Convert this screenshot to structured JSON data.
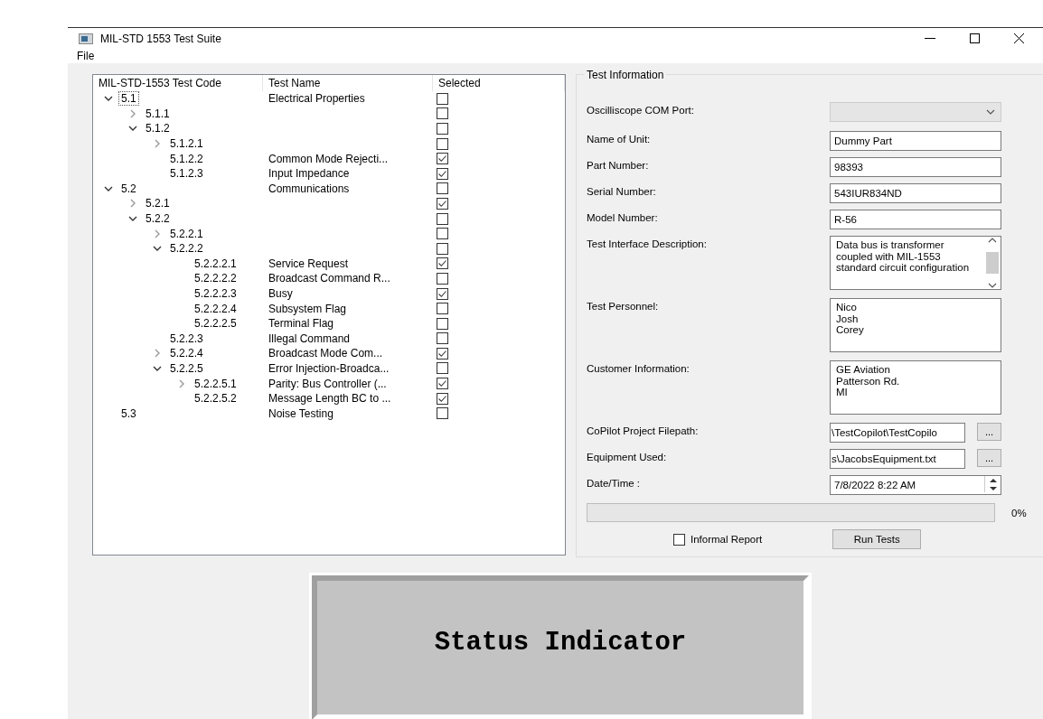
{
  "window": {
    "title": "MIL-STD 1553 Test Suite"
  },
  "menu": [
    "File"
  ],
  "tree": {
    "columns": [
      "MIL-STD-1553 Test Code",
      "Test Name",
      "Selected"
    ],
    "items": [
      {
        "code": "5.1",
        "name": "Electrical Properties",
        "checked": false,
        "selected": true,
        "expanded": true,
        "children": [
          {
            "code": "5.1.1",
            "checked": false,
            "selected": false,
            "expanded": false
          },
          {
            "code": "5.1.2",
            "checked": false,
            "selected": false,
            "expanded": true,
            "children": [
              {
                "code": "5.1.2.1",
                "checked": false,
                "selected": false,
                "expanded": false
              },
              {
                "code": "5.1.2.2",
                "name": "Common Mode Rejecti...",
                "checked": true,
                "selected": false
              },
              {
                "code": "5.1.2.3",
                "name": "Input Impedance",
                "checked": true,
                "selected": false
              }
            ]
          }
        ]
      },
      {
        "code": "5.2",
        "name": "Communications",
        "checked": false,
        "selected": false,
        "expanded": true,
        "children": [
          {
            "code": "5.2.1",
            "checked": true,
            "selected": false,
            "expanded": false
          },
          {
            "code": "5.2.2",
            "checked": false,
            "selected": false,
            "expanded": true,
            "children": [
              {
                "code": "5.2.2.1",
                "checked": false,
                "selected": false,
                "expanded": false
              },
              {
                "code": "5.2.2.2",
                "checked": false,
                "selected": false,
                "expanded": true,
                "children": [
                  {
                    "code": "5.2.2.2.1",
                    "name": "Service Request",
                    "checked": true,
                    "selected": false
                  },
                  {
                    "code": "5.2.2.2.2",
                    "name": "Broadcast Command R...",
                    "checked": false,
                    "selected": false
                  },
                  {
                    "code": "5.2.2.2.3",
                    "name": "Busy",
                    "checked": true,
                    "selected": false
                  },
                  {
                    "code": "5.2.2.2.4",
                    "name": "Subsystem Flag",
                    "checked": false,
                    "selected": false
                  },
                  {
                    "code": "5.2.2.2.5",
                    "name": "Terminal Flag",
                    "checked": false,
                    "selected": false
                  }
                ]
              },
              {
                "code": "5.2.2.3",
                "name": "Illegal Command",
                "checked": false,
                "selected": false
              },
              {
                "code": "5.2.2.4",
                "name": "Broadcast Mode Com...",
                "checked": true,
                "selected": false,
                "expanded": false
              },
              {
                "code": "5.2.2.5",
                "name": "Error Injection-Broadca...",
                "checked": false,
                "selected": false,
                "expanded": true,
                "children": [
                  {
                    "code": "5.2.2.5.1",
                    "name": "Parity: Bus Controller (...",
                    "checked": true,
                    "selected": false,
                    "expanded": false
                  },
                  {
                    "code": "5.2.2.5.2",
                    "name": "Message Length BC to ...",
                    "checked": true,
                    "selected": false
                  }
                ]
              }
            ]
          }
        ]
      },
      {
        "code": "5.3",
        "name": "Noise Testing",
        "checked": false,
        "selected": false
      }
    ]
  },
  "test_information": {
    "title": "Test Information",
    "fields": [
      {
        "kind": "combo",
        "label": "Oscilliscope COM Port:"
      },
      {
        "kind": "text",
        "label": "Name of Unit:",
        "value": "Dummy Part"
      },
      {
        "kind": "text",
        "label": "Part Number:",
        "value": "98393"
      },
      {
        "kind": "text",
        "label": "Serial Number:",
        "value": "543IUR834ND"
      },
      {
        "kind": "text",
        "label": "Model Number:",
        "value": "R-56"
      },
      {
        "kind": "scrolltext",
        "label": "Test Interface Description:",
        "value": "Data bus is transformer coupled with MIL-1553 standard circuit configuration"
      },
      {
        "kind": "multiline",
        "label": "Test Personnel:",
        "lines": [
          "Nico",
          "Josh",
          "Corey"
        ]
      },
      {
        "kind": "multiline",
        "label": "Customer Information:",
        "lines": [
          "GE Aviation",
          "Patterson Rd.",
          "MI"
        ]
      },
      {
        "kind": "browse",
        "label": "CoPilot Project Filepath:",
        "value": "\\TestCopilot\\TestCopilo",
        "button": "..."
      },
      {
        "kind": "browse",
        "label": "Equipment Used:",
        "value": "s\\JacobsEquipment.txt",
        "button": "..."
      },
      {
        "kind": "datetime",
        "label": "Date/Time :",
        "value": "7/8/2022 8:22 AM"
      }
    ],
    "progress": {
      "level": 0,
      "reading": "0%"
    },
    "informal_report": {
      "label": "Informal Report",
      "checked": false
    },
    "run_button": "Run Tests"
  },
  "status_indicator": {
    "label": "Status Indicator"
  }
}
